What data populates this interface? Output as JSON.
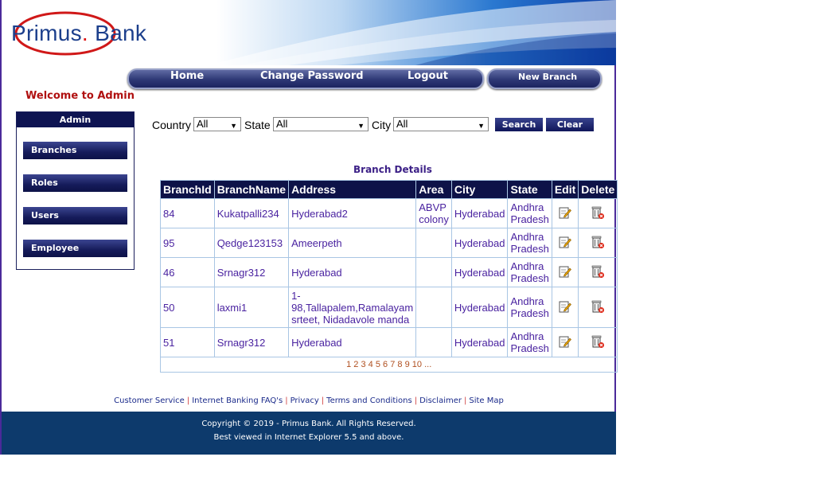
{
  "brand": {
    "logo_name": "Primus",
    "logo_dot": ".",
    "logo_suffix": "Bank"
  },
  "nav": {
    "home": "Home",
    "change_password": "Change Password",
    "logout": "Logout",
    "new_branch": "New Branch"
  },
  "welcome": "Welcome to Admin",
  "sidebar": {
    "title": "Admin",
    "items": [
      {
        "label": "Branches"
      },
      {
        "label": "Roles"
      },
      {
        "label": "Users"
      },
      {
        "label": "Employee"
      }
    ]
  },
  "search": {
    "country_label": "Country",
    "country_value": "All",
    "state_label": "State",
    "state_value": "All",
    "city_label": "City",
    "city_value": "All",
    "search_button": "Search",
    "clear_button": "Clear"
  },
  "table": {
    "title": "Branch Details",
    "columns": [
      "BranchId",
      "BranchName",
      "Address",
      "Area",
      "City",
      "State",
      "Edit",
      "Delete"
    ],
    "rows": [
      {
        "id": "84",
        "name": "Kukatpalli234",
        "address": "Hyderabad2",
        "area": "ABVP colony",
        "city": "Hyderabad",
        "state": "Andhra Pradesh"
      },
      {
        "id": "95",
        "name": "Qedge123153",
        "address": "Ameerpeth",
        "area": "",
        "city": "Hyderabad",
        "state": "Andhra Pradesh"
      },
      {
        "id": "46",
        "name": "Srnagr312",
        "address": "Hyderabad",
        "area": "",
        "city": "Hyderabad",
        "state": "Andhra Pradesh"
      },
      {
        "id": "50",
        "name": "laxmi1",
        "address": "1-98,Tallapalem,Ramalayam srteet, Nidadavole manda",
        "area": "",
        "city": "Hyderabad",
        "state": "Andhra Pradesh"
      },
      {
        "id": "51",
        "name": "Srnagr312",
        "address": "Hyderabad",
        "area": "",
        "city": "Hyderabad",
        "state": "Andhra Pradesh"
      }
    ],
    "pager": [
      "1",
      "2",
      "3",
      "4",
      "5",
      "6",
      "7",
      "8",
      "9",
      "10",
      "..."
    ],
    "edit_icon": "edit-icon",
    "delete_icon": "trash-icon"
  },
  "footer": {
    "links": [
      "Customer Service",
      "Internet Banking FAQ's",
      "Privacy",
      "Terms and Conditions",
      "Disclaimer",
      "Site Map"
    ],
    "copyright": "Copyright © 2019 - Primus Bank. All Rights Reserved.",
    "browser_note": "Best viewed in Internet Explorer 5.5 and above."
  },
  "colors": {
    "navy": "#0d1248",
    "frame": "#4b2a9a",
    "welcome": "#b01010",
    "footer_bg": "#0d3a6c",
    "link": "#4a23a0"
  }
}
